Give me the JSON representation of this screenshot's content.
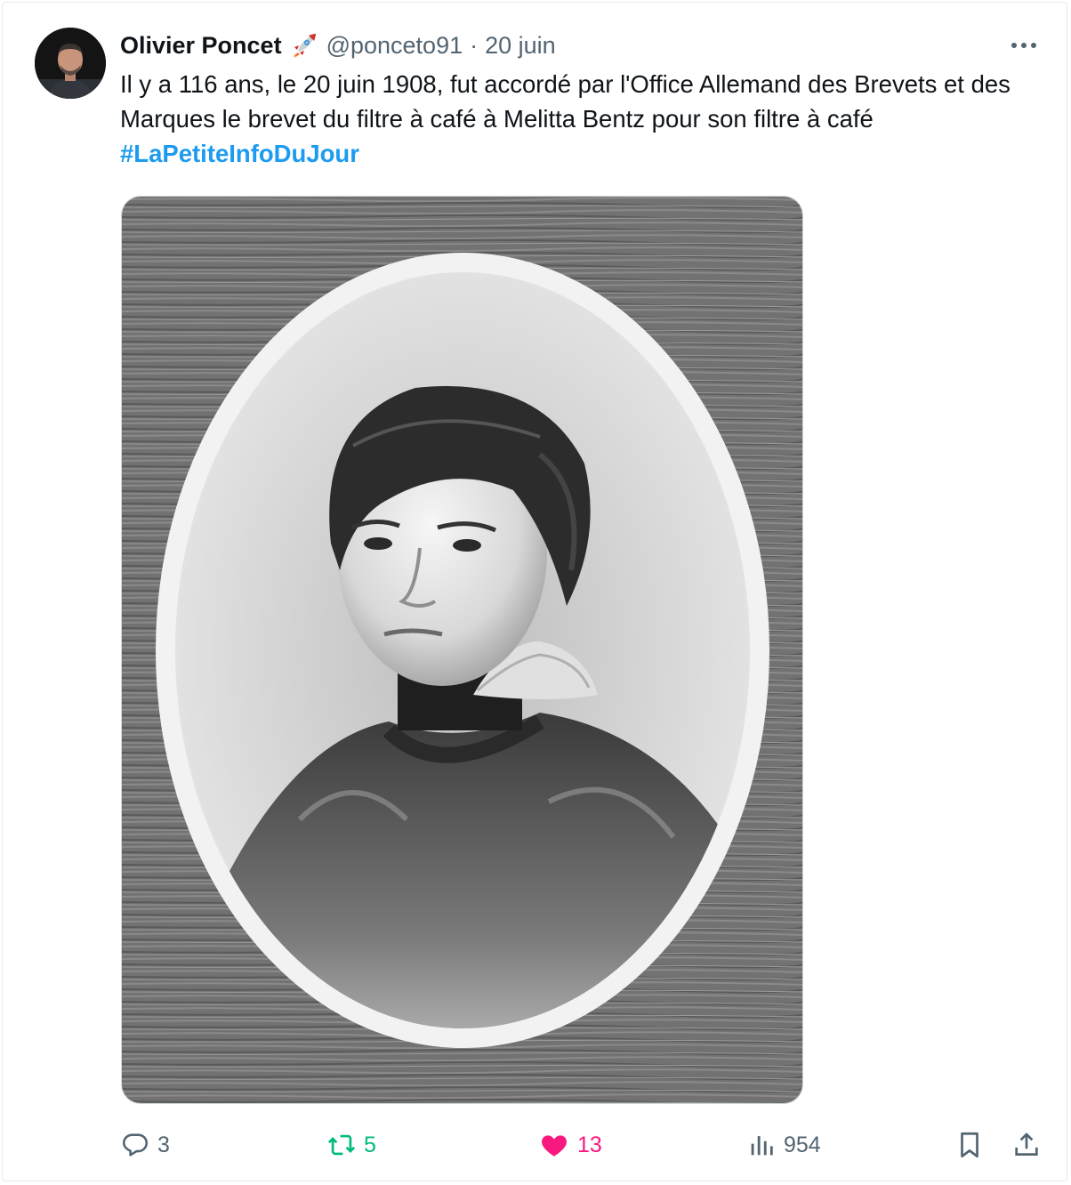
{
  "tweet": {
    "author_name": "Olivier Poncet",
    "author_handle": "@ponceto91",
    "separator": "·",
    "date": "20 juin",
    "text": "Il y a 116 ans, le 20 juin 1908, fut accordé par l'Office Allemand des Brevets et des Marques le brevet du filtre à café à Melitta Bentz pour son filtre à café",
    "hashtag": "#LaPetiteInfoDuJour",
    "badge_icon": "rocket-icon",
    "media_description_icon": "portrait-photo"
  },
  "actions": {
    "reply_count": "3",
    "retweet_count": "5",
    "like_count": "13",
    "views_count": "954"
  },
  "colors": {
    "text": "#0f1419",
    "secondary": "#536471",
    "link": "#1d9bf0",
    "retweet": "#00ba7c",
    "like": "#f91880"
  }
}
